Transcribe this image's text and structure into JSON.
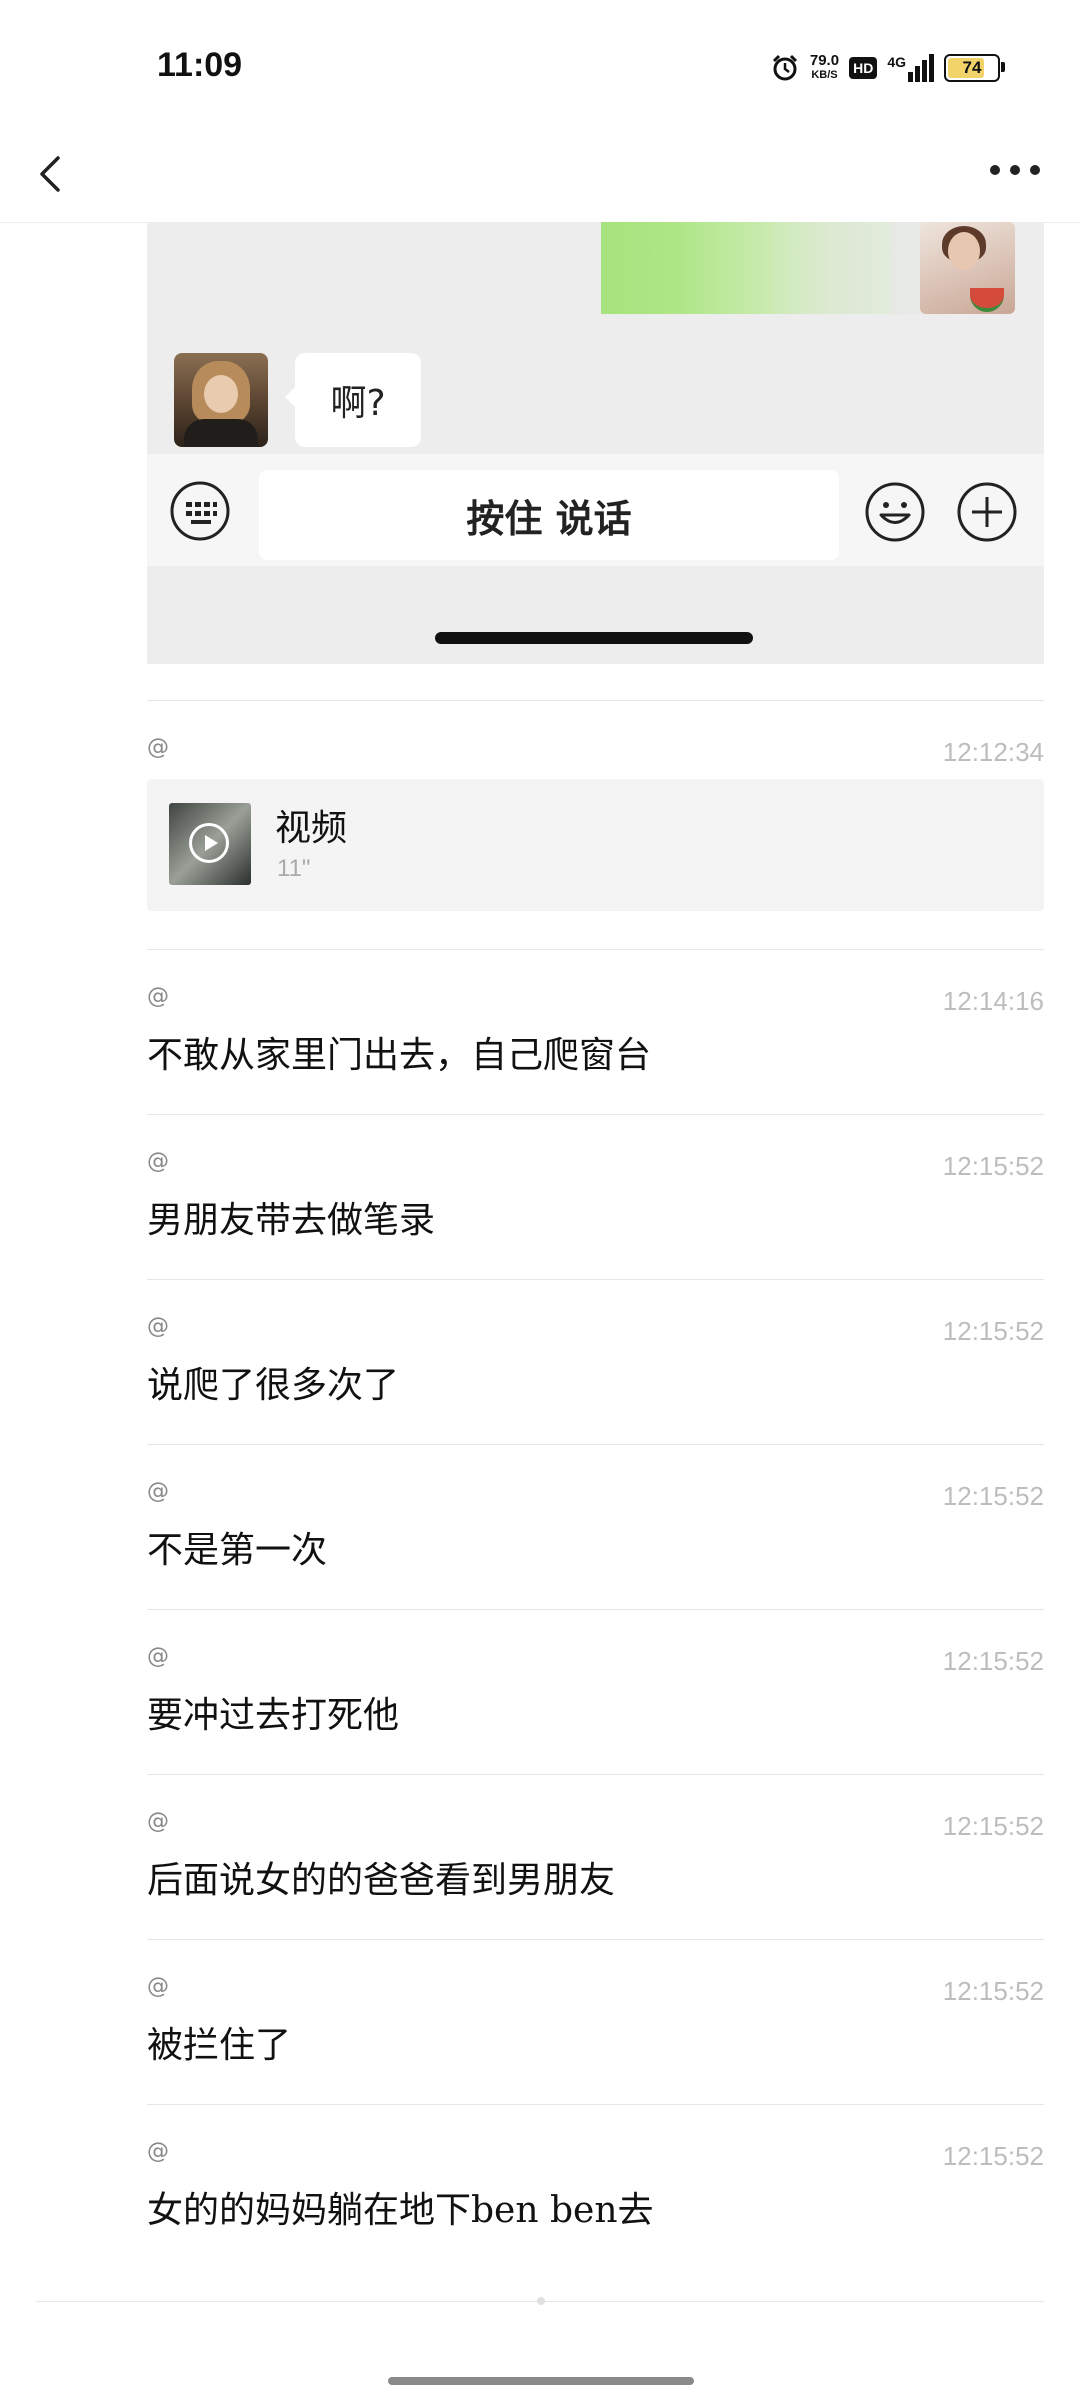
{
  "status_bar": {
    "time": "11:09",
    "net_speed": "79.0",
    "net_unit": "KB/S",
    "hd": "HD",
    "network": "4G",
    "battery": "74"
  },
  "embedded_chat": {
    "reply_text": "啊?",
    "hold_to_talk": "按住 说话",
    "bubble_color": "#a6e27e"
  },
  "messages": [
    {
      "at": "@",
      "time": "12:12:34",
      "type": "video",
      "title": "视频",
      "duration": "11\""
    },
    {
      "at": "@",
      "time": "12:14:16",
      "text": "不敢从家里门出去，自己爬窗台"
    },
    {
      "at": "@",
      "time": "12:15:52",
      "text": "男朋友带去做笔录"
    },
    {
      "at": "@",
      "time": "12:15:52",
      "text": "说爬了很多次了"
    },
    {
      "at": "@",
      "time": "12:15:52",
      "text": "不是第一次"
    },
    {
      "at": "@",
      "time": "12:15:52",
      "text": "要冲过去打死他"
    },
    {
      "at": "@",
      "time": "12:15:52",
      "text": "后面说女的的爸爸看到男朋友"
    },
    {
      "at": "@",
      "time": "12:15:52",
      "text": "被拦住了"
    },
    {
      "at": "@",
      "time": "12:15:52",
      "text": "女的的妈妈躺在地下ben ben去"
    }
  ]
}
